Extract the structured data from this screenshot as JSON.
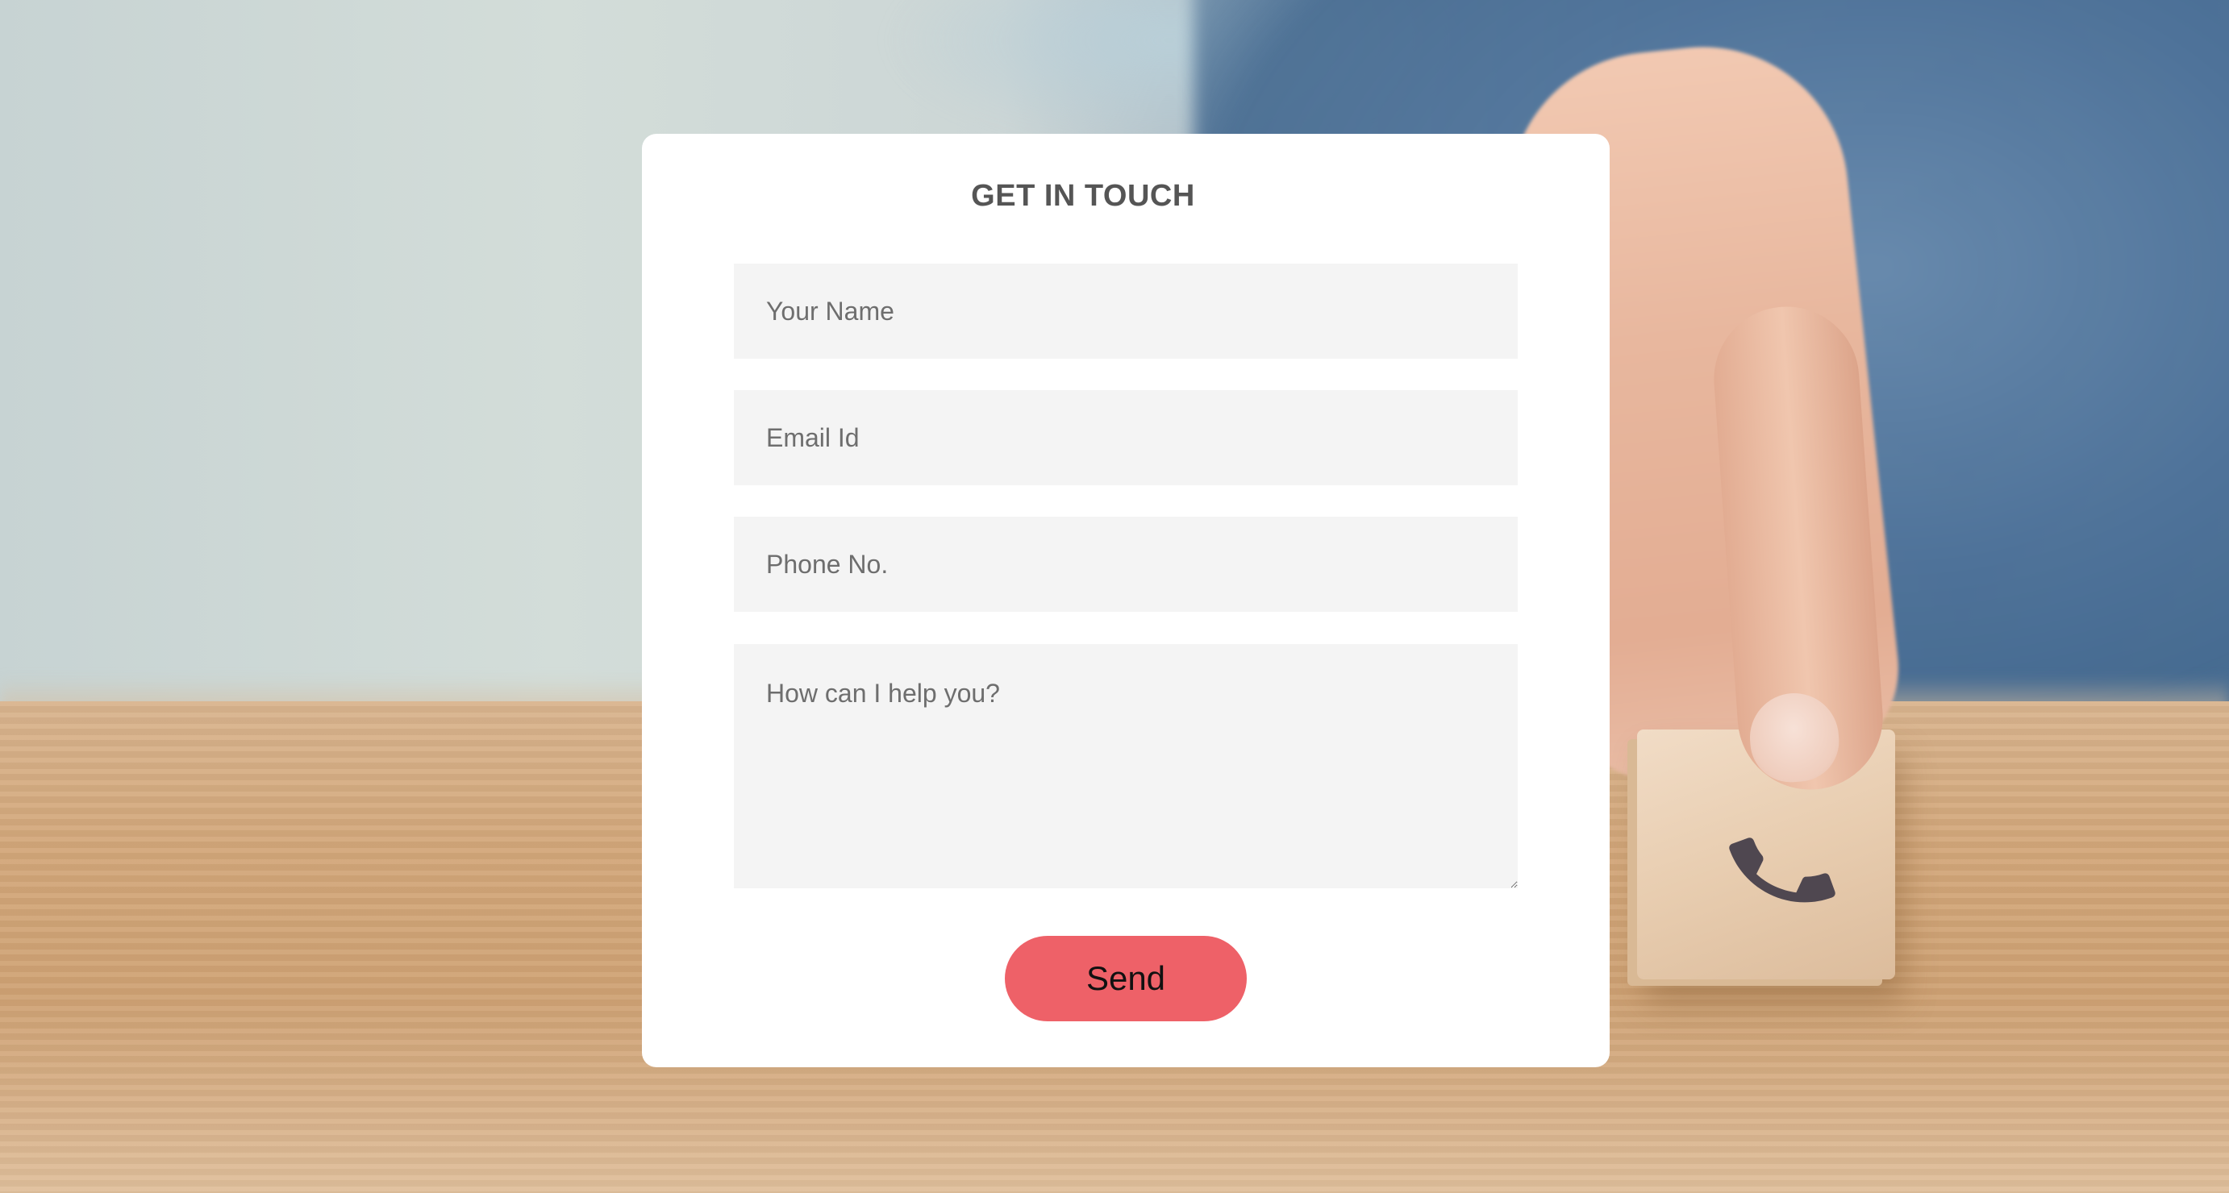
{
  "contact_form": {
    "title": "GET IN TOUCH",
    "name_placeholder": "Your Name",
    "email_placeholder": "Email Id",
    "phone_placeholder": "Phone No.",
    "message_placeholder": "How can I help you?",
    "send_label": "Send"
  },
  "theme": {
    "accent": "#ee6168",
    "field_background": "#f4f4f4",
    "card_background": "#ffffff",
    "title_color": "#555555"
  },
  "background": {
    "cube_icon": "phone-icon"
  }
}
